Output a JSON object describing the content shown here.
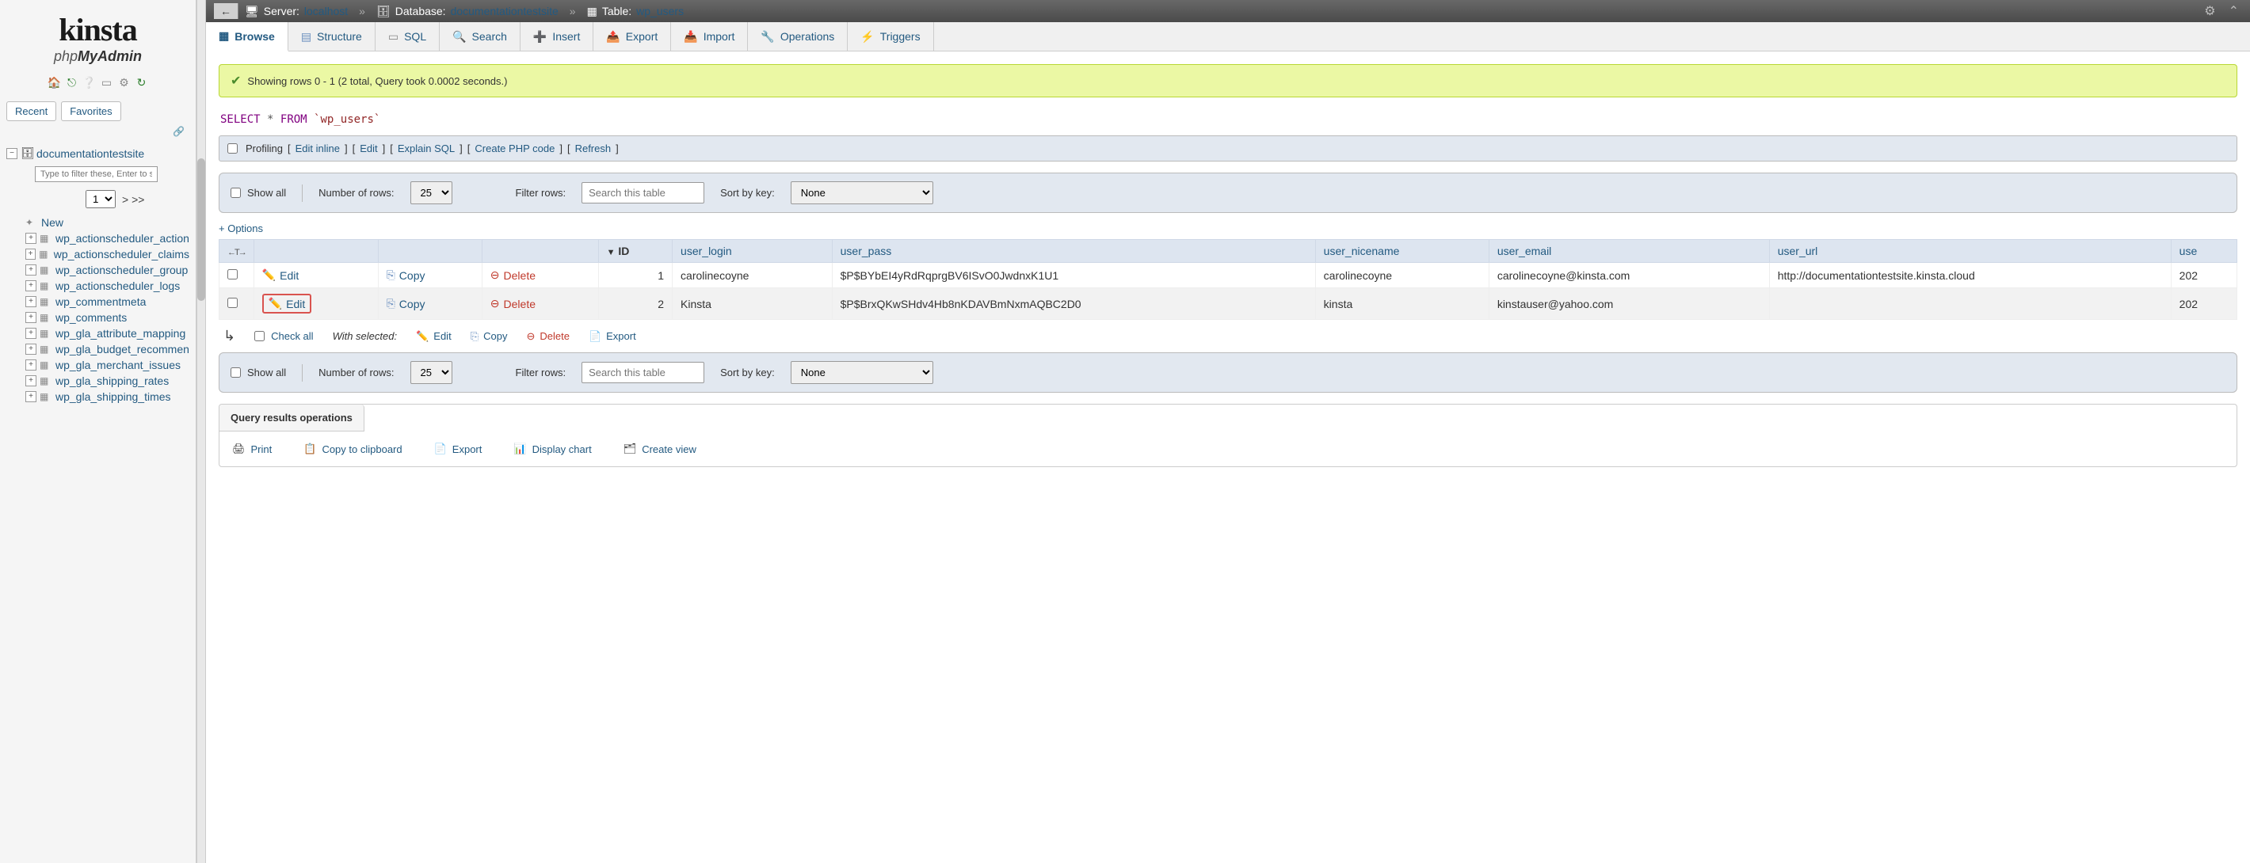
{
  "logo": {
    "brand": "kinsta",
    "phpmy": "php",
    "admin": "MyAdmin"
  },
  "side_tabs": {
    "recent": "Recent",
    "favorites": "Favorites"
  },
  "tree": {
    "db": "documentationtestsite",
    "filter_placeholder": "Type to filter these, Enter to se",
    "page_select": "1",
    "pager": "> >>",
    "new": "New",
    "tables": [
      "wp_actionscheduler_action",
      "wp_actionscheduler_claims",
      "wp_actionscheduler_group",
      "wp_actionscheduler_logs",
      "wp_commentmeta",
      "wp_comments",
      "wp_gla_attribute_mapping",
      "wp_gla_budget_recommen",
      "wp_gla_merchant_issues",
      "wp_gla_shipping_rates",
      "wp_gla_shipping_times"
    ]
  },
  "breadcrumb": {
    "server_lbl": "Server:",
    "server": "localhost",
    "db_lbl": "Database:",
    "db": "documentationtestsite",
    "table_lbl": "Table:",
    "table": "wp_users"
  },
  "tabs": {
    "browse": "Browse",
    "structure": "Structure",
    "sql": "SQL",
    "search": "Search",
    "insert": "Insert",
    "export": "Export",
    "import": "Import",
    "operations": "Operations",
    "triggers": "Triggers"
  },
  "success": "Showing rows 0 - 1 (2 total, Query took 0.0002 seconds.)",
  "sql": {
    "select": "SELECT",
    "star": "*",
    "from": "FROM",
    "tbl": "`wp_users`"
  },
  "query_actions": {
    "profiling": "Profiling",
    "edit_inline": "Edit inline",
    "edit": "Edit",
    "explain": "Explain SQL",
    "create_php": "Create PHP code",
    "refresh": "Refresh"
  },
  "controls": {
    "show_all": "Show all",
    "num_rows_lbl": "Number of rows:",
    "num_rows_val": "25",
    "filter_lbl": "Filter rows:",
    "filter_placeholder": "Search this table",
    "sort_lbl": "Sort by key:",
    "sort_val": "None"
  },
  "options": "+ Options",
  "columns": {
    "id": "ID",
    "user_login": "user_login",
    "user_pass": "user_pass",
    "user_nicename": "user_nicename",
    "user_email": "user_email",
    "user_url": "user_url",
    "user": "use"
  },
  "row_actions": {
    "edit": "Edit",
    "copy": "Copy",
    "delete": "Delete"
  },
  "rows": [
    {
      "id": "1",
      "user_login": "carolinecoyne",
      "user_pass": "$P$BYbEI4yRdRqprgBV6ISvO0JwdnxK1U1",
      "user_nicename": "carolinecoyne",
      "user_email": "carolinecoyne@kinsta.com",
      "user_url": "http://documentationtestsite.kinsta.cloud",
      "user": "202"
    },
    {
      "id": "2",
      "user_login": "Kinsta",
      "user_pass": "$P$BrxQKwSHdv4Hb8nKDAVBmNxmAQBC2D0",
      "user_nicename": "kinsta",
      "user_email": "kinstauser@yahoo.com",
      "user_url": "",
      "user": "202"
    }
  ],
  "bulk": {
    "check_all": "Check all",
    "with_selected": "With selected:",
    "edit": "Edit",
    "copy": "Copy",
    "delete": "Delete",
    "export": "Export"
  },
  "ops": {
    "header": "Query results operations",
    "print": "Print",
    "copy_clip": "Copy to clipboard",
    "export": "Export",
    "chart": "Display chart",
    "create_view": "Create view"
  }
}
